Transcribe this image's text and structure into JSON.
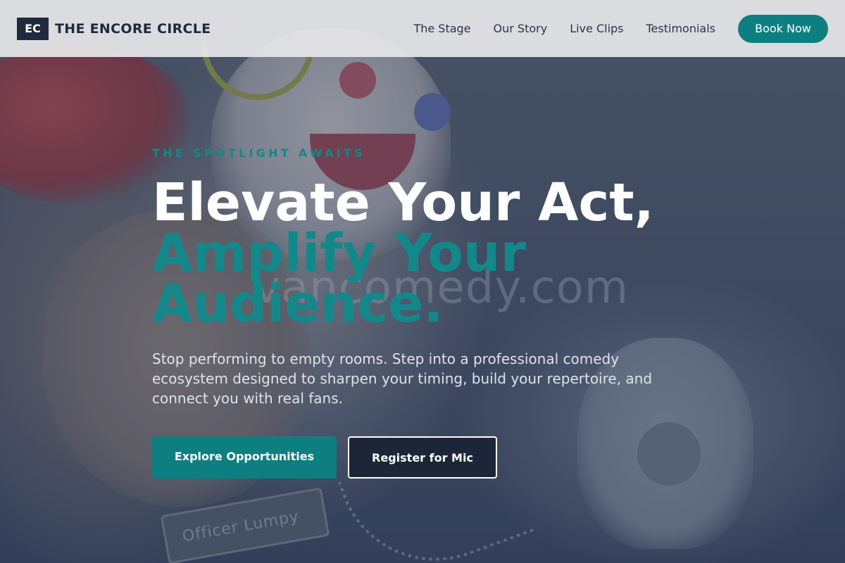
{
  "header": {
    "logo_mark": "EC",
    "brand": "THE ENCORE CIRCLE",
    "nav": [
      "The Stage",
      "Our Story",
      "Live Clips",
      "Testimonials"
    ],
    "cta": "Book Now"
  },
  "hero": {
    "eyebrow": "THE SPOTLIGHT AWAITS",
    "headline_line1": "Elevate Your Act,",
    "headline_line2": "Amplify Your Audience.",
    "subtext": "Stop performing to empty rooms. Step into a professional comedy ecosystem designed to sharpen your timing, build your repertoire, and connect you with real fans.",
    "primary_button": "Explore Opportunities",
    "secondary_button": "Register for Mic"
  },
  "background": {
    "watermark": "vancomedy.com",
    "nametag": "Officer Lumpy"
  },
  "colors": {
    "accent": "#0e7f80",
    "accent_text": "#13888a",
    "navy": "#1f2a3c"
  }
}
